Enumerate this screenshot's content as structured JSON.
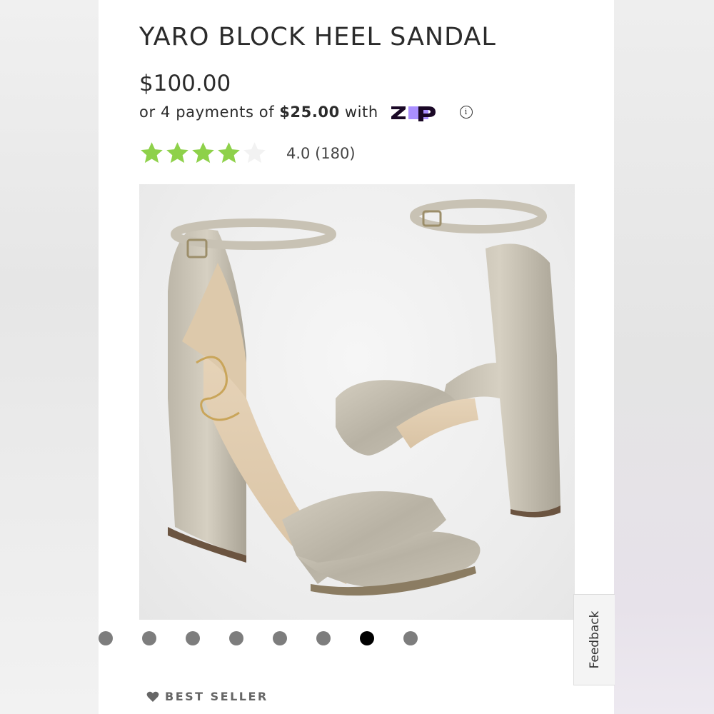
{
  "product": {
    "title": "YARO BLOCK HEEL SANDAL",
    "price": "$100.00"
  },
  "payment": {
    "prefix": "or 4 payments of",
    "amount": "$25.00",
    "suffix": "with",
    "provider": "zip",
    "provider_logo_icon": "zip-logo-icon",
    "info_icon": "info-icon"
  },
  "rating": {
    "value": 4.0,
    "max": 5,
    "score_text": "4.0",
    "count_text": "(180)",
    "star_color": "#8ed14a",
    "empty_star_color": "#f2f2f2"
  },
  "gallery": {
    "image_alt": "silver glitter block heel ankle strap sandals",
    "total_images": 8,
    "active_index": 6
  },
  "feedback": {
    "label": "Feedback"
  },
  "badge": {
    "label": "BEST SELLER",
    "icon": "heart-icon"
  },
  "colors": {
    "text": "#2b2b2b",
    "zip_purple": "#aa8fff",
    "zip_dark": "#1a0826"
  }
}
